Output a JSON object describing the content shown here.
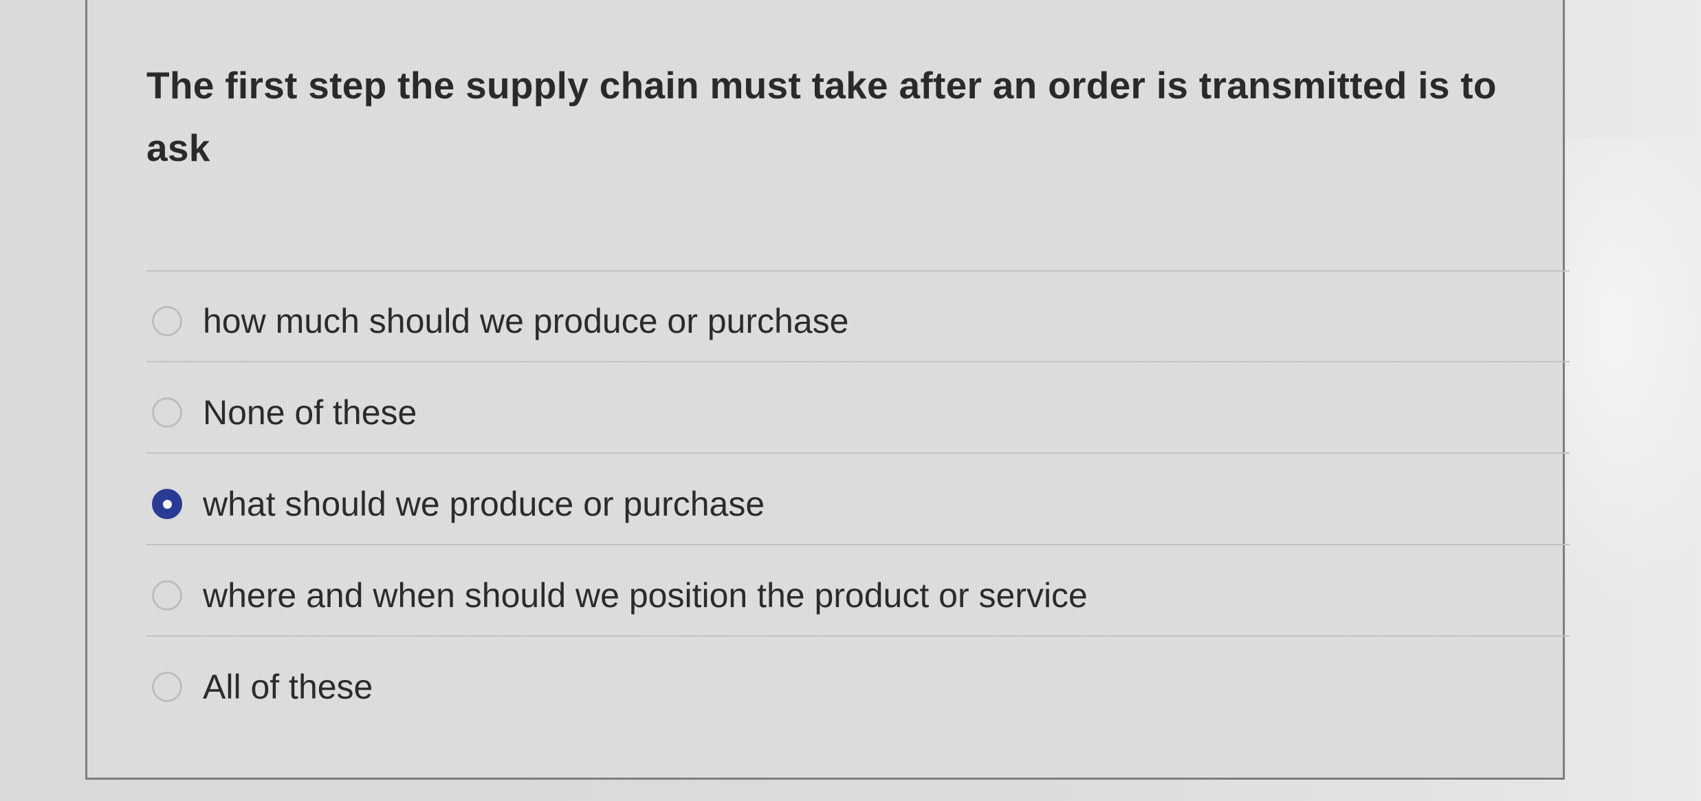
{
  "question": {
    "text": "The first step the supply chain must take after an order is transmitted is to ask"
  },
  "options": [
    {
      "label": "how much should we produce or purchase",
      "selected": false
    },
    {
      "label": "None of these",
      "selected": false
    },
    {
      "label": "what should we produce or purchase",
      "selected": true
    },
    {
      "label": "where and when should we position the product or service",
      "selected": false
    },
    {
      "label": "All of these",
      "selected": false
    }
  ],
  "colors": {
    "selected_radio": "#2a3b96",
    "text": "#2b2b2b",
    "card_border": "#7d7d7b"
  }
}
